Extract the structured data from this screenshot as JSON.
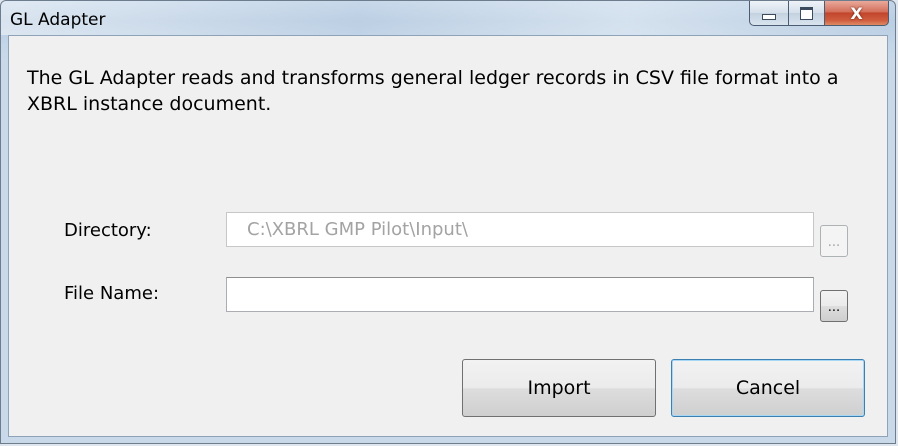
{
  "window": {
    "title": "GL Adapter",
    "close_glyph": "X"
  },
  "dialog": {
    "description": "The GL Adapter reads and transforms general ledger records in CSV file format into a XBRL instance document.",
    "directory": {
      "label": "Directory:",
      "value": "C:\\XBRL GMP Pilot\\Input\\",
      "enabled": false,
      "browse_label": "..."
    },
    "file_name": {
      "label": "File Name:",
      "value": "",
      "enabled": true,
      "browse_label": "..."
    },
    "import_label": "Import",
    "cancel_label": "Cancel"
  },
  "icons": {
    "minimize": "minimize-icon",
    "maximize": "maximize-icon",
    "close": "close-icon"
  },
  "colors": {
    "titlebar": "#c6d8ea",
    "client_bg": "#f0f0f0",
    "close_button": "#c2462c",
    "disabled_text": "#a3a3a3"
  }
}
